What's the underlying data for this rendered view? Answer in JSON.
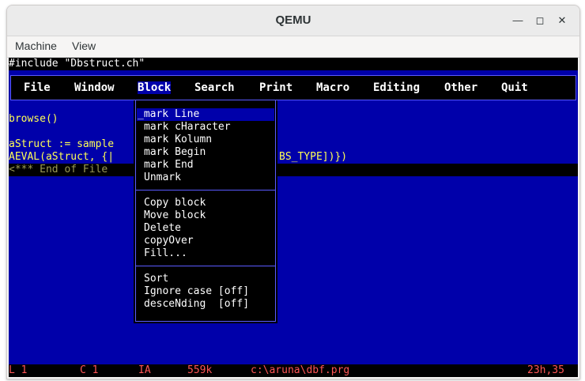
{
  "window": {
    "title": "QEMU"
  },
  "menubar": {
    "items": [
      "Machine",
      "View"
    ]
  },
  "editor": {
    "header_line": "#include \"Dbstruct.ch\"",
    "lines": {
      "browse": "browse()",
      "astruct": "aStruct := sample",
      "aeval_left": "AEVAL(aStruct, {|",
      "aeval_right": "BS_TYPE])})",
      "eof": "<*** End of File"
    }
  },
  "dos_menu": {
    "items": [
      "File",
      "Window",
      "Block",
      "Search",
      "Print",
      "Macro",
      "Editing",
      "Other",
      "Quit"
    ],
    "selected": "Block"
  },
  "block_menu": {
    "group1": [
      "_mark Line",
      "mark cHaracter",
      "mark Kolumn",
      "mark Begin",
      "mark End",
      "Unmark"
    ],
    "group2": [
      "Copy block",
      "Move block",
      "Delete",
      "copyOver",
      "Fill..."
    ],
    "group3": [
      "Sort",
      "Ignore case [off]",
      "desceNding  [off]"
    ]
  },
  "status": {
    "line": "L 1",
    "col": "C 1",
    "mode": "IA",
    "memory": "559k",
    "file": "c:\\aruna\\dbf.prg",
    "clock": "23h,35"
  },
  "colors": {
    "screen_bg": "#0000aa",
    "text_yellow": "#ffff55",
    "status_red": "#ff5555",
    "highlight": "#0000aa"
  }
}
